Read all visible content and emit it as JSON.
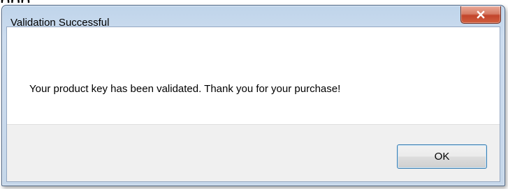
{
  "background": {
    "partial_text": "ppp"
  },
  "dialog": {
    "title": "Validation Successful",
    "message": "Your product key has been validated. Thank you for your purchase!",
    "ok_label": "OK"
  },
  "icons": {
    "close": "close-icon"
  },
  "colors": {
    "close_button_red": "#c2442b",
    "titlebar_blue": "#bfd4ea",
    "footer_gray": "#f0f0f0",
    "ok_border_blue": "#3c7fb1"
  }
}
